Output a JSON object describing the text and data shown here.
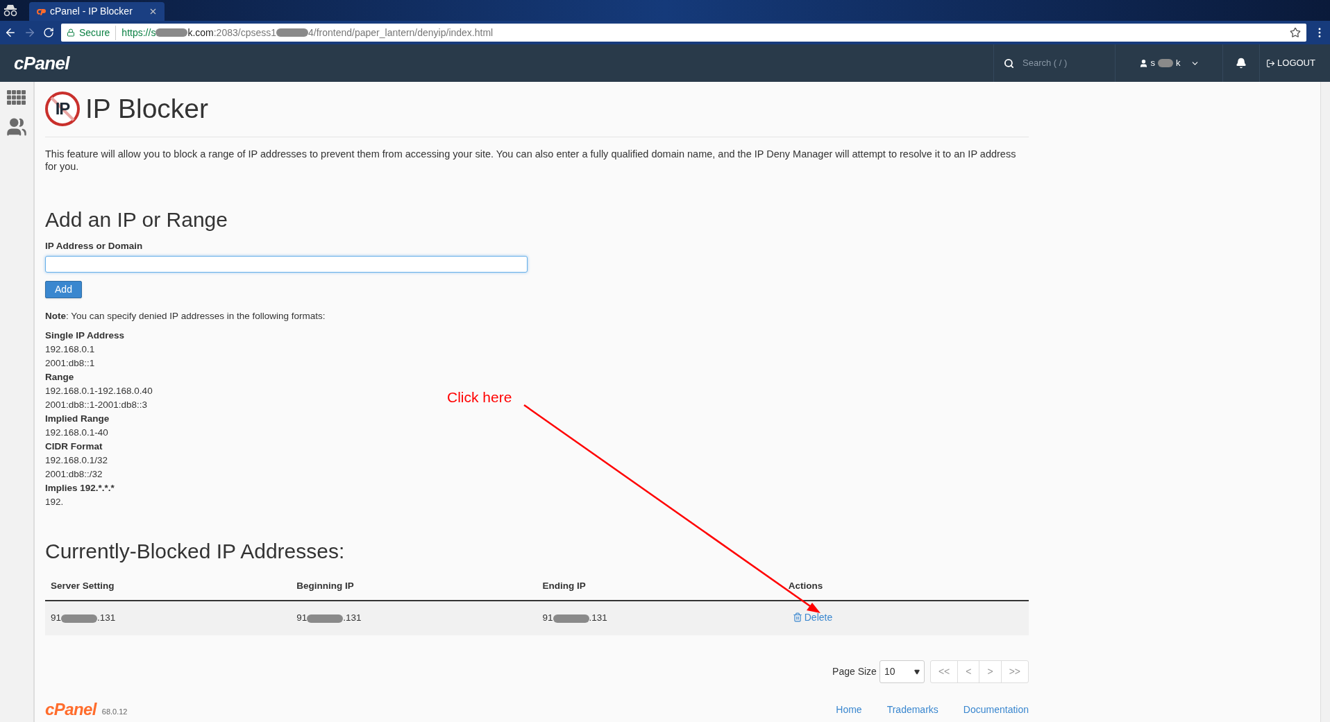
{
  "browser": {
    "tab_title": "cPanel - IP Blocker",
    "secure_label": "Secure",
    "url": [
      {
        "kind": "scheme",
        "text": "https://s"
      },
      {
        "kind": "redacted"
      },
      {
        "kind": "host",
        "text": "k.com"
      },
      {
        "kind": "path",
        "text": ":2083/cpsess1"
      },
      {
        "kind": "redacted"
      },
      {
        "kind": "path",
        "text": "4/frontend/paper_lantern/denyip/index.html"
      }
    ]
  },
  "header": {
    "logo": "cPanel",
    "search_placeholder": "Search ( / )",
    "user": [
      {
        "kind": "text",
        "text": "s"
      },
      {
        "kind": "redacted"
      },
      {
        "kind": "text",
        "text": "k"
      }
    ],
    "logout": "LOGOUT"
  },
  "page": {
    "icon_text": "IP",
    "title": "IP Blocker",
    "description": "This feature will allow you to block a range of IP addresses to prevent them from accessing your site. You can also enter a fully qualified domain name, and the IP Deny Manager will attempt to resolve it to an IP address for you.",
    "add_heading": "Add an IP or Range",
    "field_label": "IP Address or Domain",
    "add_button": "Add",
    "note": "**Note**: You can specify denied IP addresses in the following formats:",
    "formats": [
      {
        "kind": "heading",
        "text": "Single IP Address"
      },
      {
        "kind": "value",
        "text": "192.168.0.1"
      },
      {
        "kind": "value",
        "text": "2001:db8::1"
      },
      {
        "kind": "heading",
        "text": "Range"
      },
      {
        "kind": "value",
        "text": "192.168.0.1-192.168.0.40"
      },
      {
        "kind": "value",
        "text": "2001:db8::1-2001:db8::3"
      },
      {
        "kind": "heading",
        "text": "Implied Range"
      },
      {
        "kind": "value",
        "text": "192.168.0.1-40"
      },
      {
        "kind": "heading",
        "text": "CIDR Format"
      },
      {
        "kind": "value",
        "text": "192.168.0.1/32"
      },
      {
        "kind": "value",
        "text": "2001:db8::/32"
      },
      {
        "kind": "heading",
        "text": "Implies 192.*.*.*"
      },
      {
        "kind": "value",
        "text": "192."
      }
    ],
    "table_heading": "Currently-Blocked IP Addresses:",
    "columns": [
      "Server Setting",
      "Beginning IP",
      "Ending IP",
      "Actions"
    ],
    "rows": [
      {
        "cells": [
          [
            {
              "kind": "text",
              "text": "91"
            },
            {
              "kind": "redacted"
            },
            {
              "kind": "text",
              "text": ".131"
            }
          ],
          [
            {
              "kind": "text",
              "text": "91"
            },
            {
              "kind": "redacted"
            },
            {
              "kind": "text",
              "text": ".131"
            }
          ],
          [
            {
              "kind": "text",
              "text": "91"
            },
            {
              "kind": "redacted"
            },
            {
              "kind": "text",
              "text": ".131"
            }
          ]
        ],
        "action": "Delete"
      }
    ],
    "pagination": {
      "label": "Page Size",
      "page_size": "10",
      "buttons": [
        "<<",
        "<",
        ">",
        ">>"
      ]
    }
  },
  "footer": {
    "logo": "cPanel",
    "version": "68.0.12",
    "links": [
      "Home",
      "Trademarks",
      "Documentation"
    ]
  },
  "annotation": {
    "text": "Click here"
  }
}
